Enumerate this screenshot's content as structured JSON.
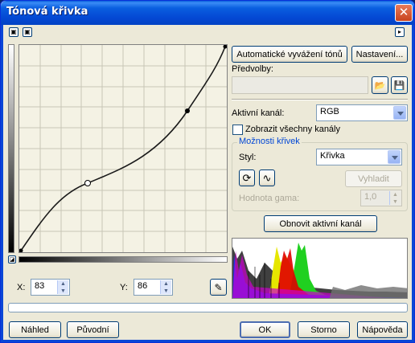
{
  "window": {
    "title": "Tónová křivka",
    "close_glyph": "✕"
  },
  "toolbar": {
    "left_icons": [
      "view-icon",
      "view-alt-icon"
    ],
    "right_icon": "arrow-right-icon"
  },
  "buttons": {
    "auto_balance": "Automatické vyvážení tónů",
    "settings": "Nastavení...",
    "reset_channel": "Obnovit aktivní kanál",
    "smooth": "Vyhladit",
    "preview": "Náhled",
    "original": "Původní",
    "ok": "OK",
    "cancel": "Storno",
    "help": "Nápověda"
  },
  "presets": {
    "label": "Předvolby:",
    "value": ""
  },
  "channel": {
    "label": "Aktivní kanál:",
    "value": "RGB"
  },
  "show_all": {
    "label": "Zobrazit všechny kanály",
    "checked": false
  },
  "curve_options": {
    "title": "Možnosti křivek",
    "style_label": "Styl:",
    "style_value": "Křivka",
    "gamma_label": "Hodnota gama:",
    "gamma_value": "1,0"
  },
  "coords": {
    "x_label": "X:",
    "x_value": "83",
    "y_label": "Y:",
    "y_value": "86"
  },
  "colors": {
    "title_bar": "#0a5fdc",
    "accent_blue": "#1c5180",
    "group_title": "#0046d5"
  }
}
